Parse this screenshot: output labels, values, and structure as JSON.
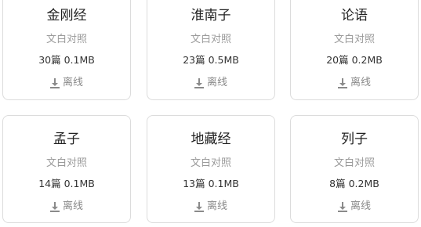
{
  "books": [
    {
      "title": "金刚经",
      "subtitle": "文白对照",
      "meta": "30篇 0.1MB",
      "download_label": "离线"
    },
    {
      "title": "淮南子",
      "subtitle": "文白对照",
      "meta": "23篇 0.5MB",
      "download_label": "离线"
    },
    {
      "title": "论语",
      "subtitle": "文白对照",
      "meta": "20篇 0.2MB",
      "download_label": "离线"
    },
    {
      "title": "孟子",
      "subtitle": "文白对照",
      "meta": "14篇 0.1MB",
      "download_label": "离线"
    },
    {
      "title": "地藏经",
      "subtitle": "文白对照",
      "meta": "13篇 0.1MB",
      "download_label": "离线"
    },
    {
      "title": "列子",
      "subtitle": "文白对照",
      "meta": "8篇 0.2MB",
      "download_label": "离线"
    }
  ],
  "icons": {
    "download": "download-icon"
  },
  "colors": {
    "title": "#222222",
    "subtitle": "#9a9a9a",
    "meta": "#333333",
    "download": "#8a8a8a",
    "card_border": "#dcdcdc"
  }
}
